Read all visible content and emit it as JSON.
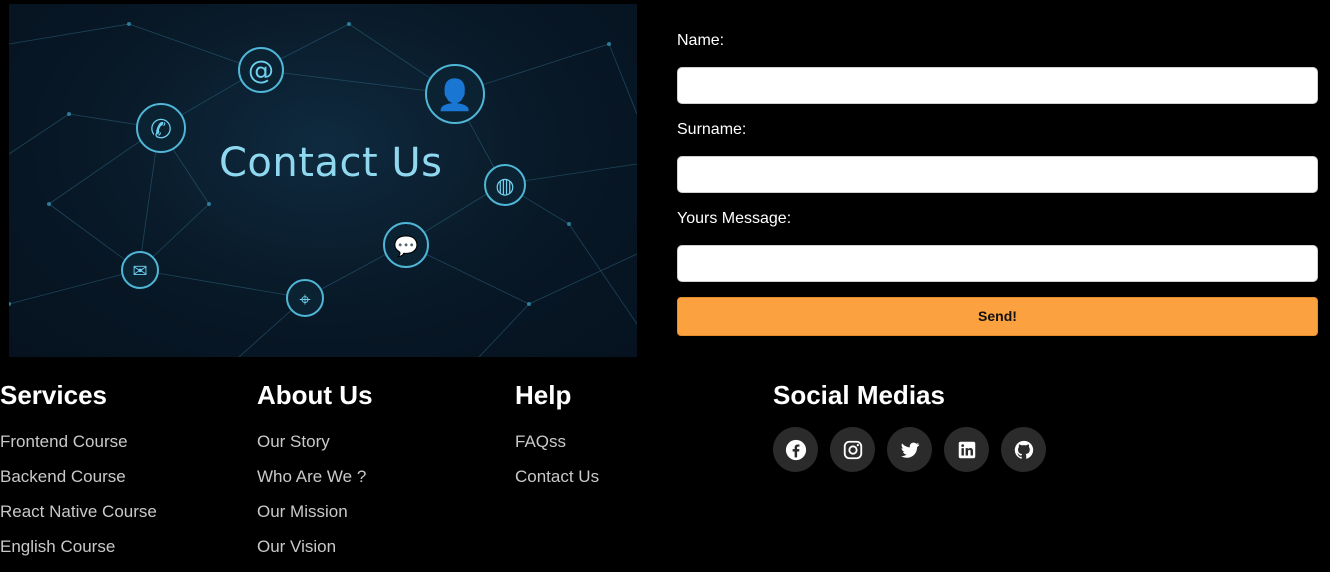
{
  "hero": {
    "title": "Contact Us"
  },
  "form": {
    "name_label": "Name:",
    "name_value": "",
    "surname_label": "Surname:",
    "surname_value": "",
    "message_label": "Yours Message:",
    "message_value": "",
    "send_label": "Send!"
  },
  "footer": {
    "services": {
      "title": "Services",
      "links": [
        "Frontend Course",
        "Backend Course",
        "React Native Course",
        "English Course"
      ]
    },
    "about": {
      "title": "About Us",
      "links": [
        "Our Story",
        "Who Are We ?",
        "Our Mission",
        "Our Vision"
      ]
    },
    "help": {
      "title": "Help",
      "links": [
        "FAQss",
        "Contact Us"
      ]
    },
    "social": {
      "title": "Social Medias",
      "icons": [
        "facebook-icon",
        "instagram-icon",
        "twitter-icon",
        "linkedin-icon",
        "github-icon"
      ]
    }
  },
  "colors": {
    "accent": "#fca13f",
    "background": "#000000",
    "social_bg": "#2b2b2b"
  }
}
